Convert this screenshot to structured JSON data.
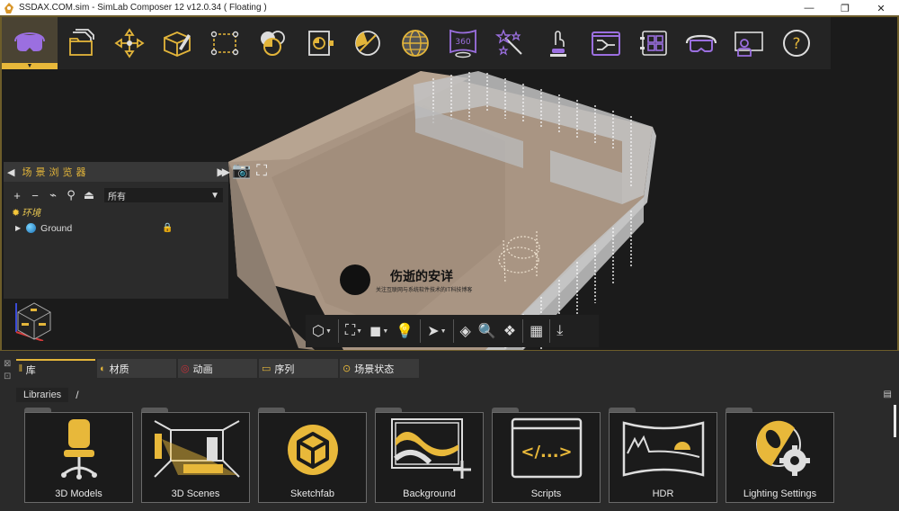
{
  "window": {
    "title": "SSDAX.COM.sim - SimLab Composer 12 v12.0.34 ( Floating )",
    "controls": {
      "minimize": "—",
      "maximize": "❐",
      "close": "✕"
    }
  },
  "colors": {
    "accent": "#e3b53a",
    "purple": "#9b6fe0",
    "border": "#6d5d2a"
  },
  "toolbar": {
    "items": [
      {
        "name": "vr-headset",
        "active": true
      },
      {
        "name": "open-files"
      },
      {
        "name": "transform-move"
      },
      {
        "name": "edit-model"
      },
      {
        "name": "selection-box"
      },
      {
        "name": "materials"
      },
      {
        "name": "render"
      },
      {
        "name": "lighting"
      },
      {
        "name": "environment-globe"
      },
      {
        "name": "panorama-360",
        "label": "360"
      },
      {
        "name": "magic-wand"
      },
      {
        "name": "interact"
      },
      {
        "name": "sequence-flow"
      },
      {
        "name": "library-grid"
      },
      {
        "name": "vr-view"
      },
      {
        "name": "presentation"
      },
      {
        "name": "help",
        "label": "?"
      }
    ]
  },
  "scene_browser": {
    "title": "场景浏览器",
    "filter_value": "所有",
    "tree": [
      {
        "label": "环境",
        "type": "environment"
      },
      {
        "label": "Ground",
        "type": "object",
        "locked": true
      }
    ]
  },
  "watermark": {
    "title": "伤逝的安详",
    "subtitle": "关注互联网与系统软件技术的IT科技博客"
  },
  "bottom_panel": {
    "tabs": [
      {
        "label": "库",
        "active": true
      },
      {
        "label": "材质"
      },
      {
        "label": "动画"
      },
      {
        "label": "序列"
      },
      {
        "label": "场景状态"
      }
    ],
    "breadcrumb": {
      "root": "Libraries",
      "separator": "/"
    },
    "libraries": [
      {
        "label": "3D Models"
      },
      {
        "label": "3D Scenes"
      },
      {
        "label": "Sketchfab"
      },
      {
        "label": "Background"
      },
      {
        "label": "Scripts"
      },
      {
        "label": "HDR"
      },
      {
        "label": "Lighting Settings"
      }
    ]
  }
}
